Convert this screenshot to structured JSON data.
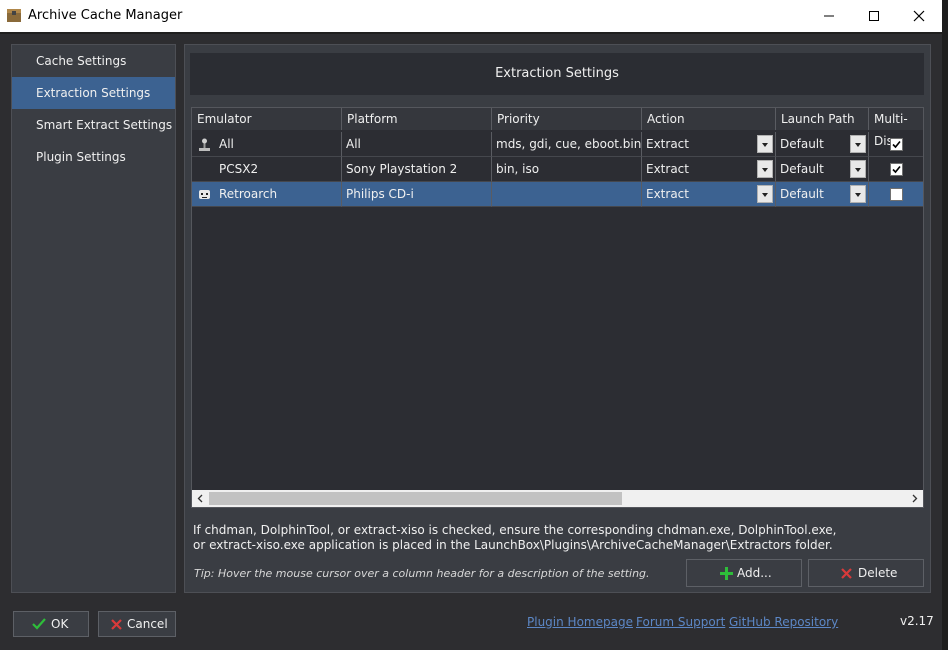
{
  "window": {
    "title": "Archive Cache Manager",
    "icon": "archive-box-icon"
  },
  "sidebar": {
    "items": [
      {
        "label": "Cache Settings",
        "active": false
      },
      {
        "label": "Extraction Settings",
        "active": true
      },
      {
        "label": "Smart Extract Settings",
        "active": false
      },
      {
        "label": "Plugin Settings",
        "active": false
      }
    ]
  },
  "panel": {
    "title": "Extraction Settings"
  },
  "grid": {
    "columns": [
      "Emulator",
      "Platform",
      "Priority",
      "Action",
      "Launch Path",
      "Multi-Disc"
    ],
    "rows": [
      {
        "emulator": "All",
        "emulator_icon": "joystick-icon",
        "platform": "All",
        "priority": "mds, gdi, cue, eboot.bin",
        "action": "Extract",
        "launch_path": "Default",
        "multi_disc": true,
        "selected": false
      },
      {
        "emulator": "PCSX2",
        "emulator_icon": "",
        "platform": "Sony Playstation 2",
        "priority": "bin, iso",
        "action": "Extract",
        "launch_path": "Default",
        "multi_disc": true,
        "selected": false
      },
      {
        "emulator": "Retroarch",
        "emulator_icon": "space-invader-icon",
        "platform": "Philips CD-i",
        "priority": "",
        "action": "Extract",
        "launch_path": "Default",
        "multi_disc": false,
        "selected": true
      }
    ]
  },
  "info": {
    "line1": "If chdman, DolphinTool, or extract-xiso is checked, ensure the corresponding chdman.exe, DolphinTool.exe,",
    "line2": "or extract-xiso.exe application is placed in the LaunchBox\\Plugins\\ArchiveCacheManager\\Extractors folder.",
    "tip": "Tip: Hover the mouse cursor over a column header for a description of the setting."
  },
  "buttons": {
    "add": "Add...",
    "delete": "Delete",
    "ok": "OK",
    "cancel": "Cancel"
  },
  "footer": {
    "links": [
      "Plugin Homepage",
      "Forum Support",
      "GitHub Repository"
    ],
    "version": "v2.17"
  },
  "colors": {
    "background": "#2d2d30",
    "panel": "#3a3d43",
    "selection": "#3c6291",
    "link": "#5c87c6",
    "add_icon": "#2ebd3a",
    "delete_icon": "#d93a3a"
  }
}
